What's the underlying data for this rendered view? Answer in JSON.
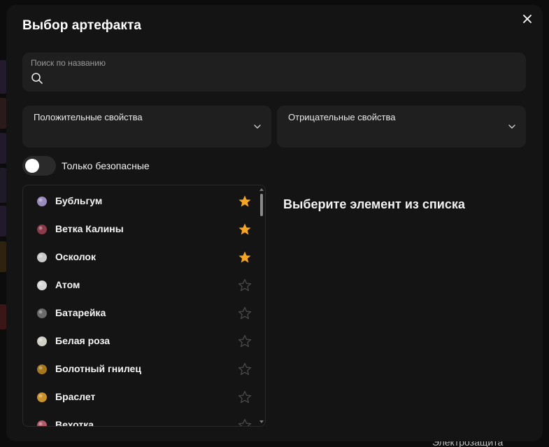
{
  "modal": {
    "title": "Выбор артефакта",
    "close_icon": "close-icon"
  },
  "search": {
    "label": "Поиск по названию",
    "value": "",
    "icon": "search-icon"
  },
  "filters": {
    "positive_label": "Положительные свойства",
    "negative_label": "Отрицательные свойства"
  },
  "toggle": {
    "label": "Только безопасные",
    "on": false
  },
  "artifacts": [
    {
      "name": "Бубльгум",
      "favorite": true,
      "icon": "bubblegum-icon",
      "color": "#9b8bbd"
    },
    {
      "name": "Ветка Калины",
      "favorite": true,
      "icon": "viburnum-branch-icon",
      "color": "#8a3a4a"
    },
    {
      "name": "Осколок",
      "favorite": true,
      "icon": "shard-icon",
      "color": "#c9c9c9"
    },
    {
      "name": "Атом",
      "favorite": false,
      "icon": "atom-icon",
      "color": "#d8d8d8"
    },
    {
      "name": "Батарейка",
      "favorite": false,
      "icon": "battery-icon",
      "color": "#6a6a6a"
    },
    {
      "name": "Белая роза",
      "favorite": false,
      "icon": "white-rose-icon",
      "color": "#cfcfc4"
    },
    {
      "name": "Болотный гнилец",
      "favorite": false,
      "icon": "swamp-rot-icon",
      "color": "#a6781e"
    },
    {
      "name": "Браслет",
      "favorite": false,
      "icon": "bracelet-icon",
      "color": "#c9922b"
    },
    {
      "name": "Вехотка",
      "favorite": false,
      "icon": "vekhotka-icon",
      "color": "#b05a6a"
    }
  ],
  "details": {
    "placeholder": "Выберите элемент из списка"
  },
  "colors": {
    "star_active": "#f5a524",
    "star_inactive": "#4a4a4a",
    "modal_bg": "#141414",
    "field_bg": "#1f1f1f"
  },
  "background": {
    "bottom_text": "Электрозащита"
  }
}
